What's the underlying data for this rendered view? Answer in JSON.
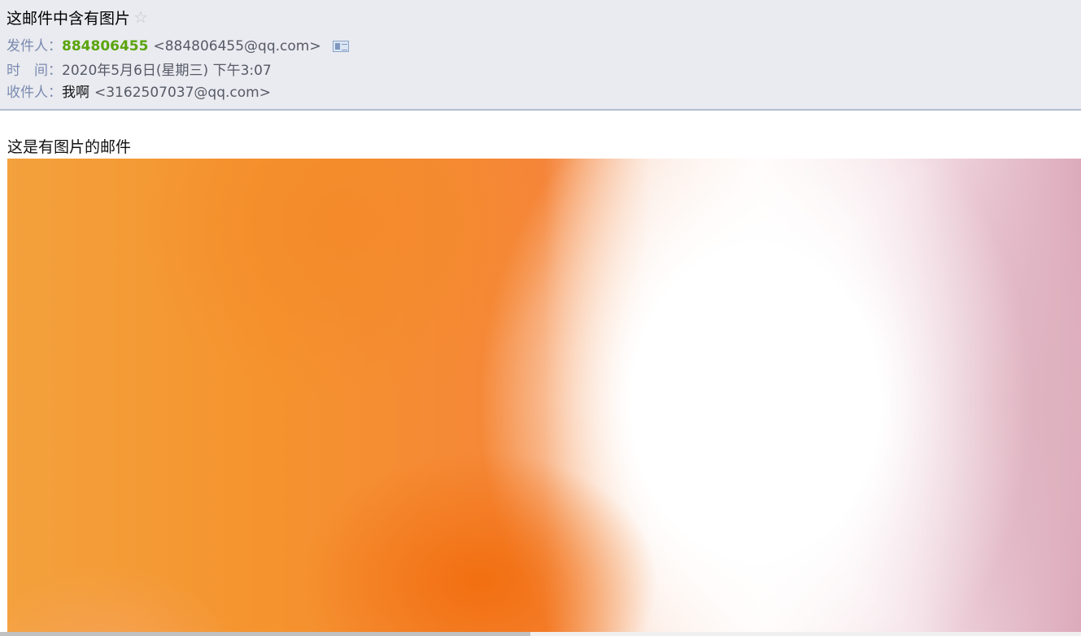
{
  "email": {
    "subject": "这邮件中含有图片",
    "star_icon": "star-outline-icon",
    "from": {
      "label": "发件人：",
      "name": "884806455",
      "address": "<884806455@qq.com>",
      "card_icon": "contact-card-icon"
    },
    "time": {
      "label": "时　间：",
      "value": "2020年5月6日(星期三) 下午3:07"
    },
    "to": {
      "label": "收件人：",
      "name": "我啊",
      "address": "<3162507037@qq.com>"
    },
    "body_text": "这是有图片的邮件",
    "image": {
      "description_colors": [
        "#f5932e",
        "#f26f10",
        "#ffffff",
        "#dcaabb"
      ]
    }
  },
  "colors": {
    "header_bg": "#eaebf0",
    "header_border": "#b6bdd2",
    "sender_name": "#5aa40e",
    "label": "#7a8ab0"
  }
}
